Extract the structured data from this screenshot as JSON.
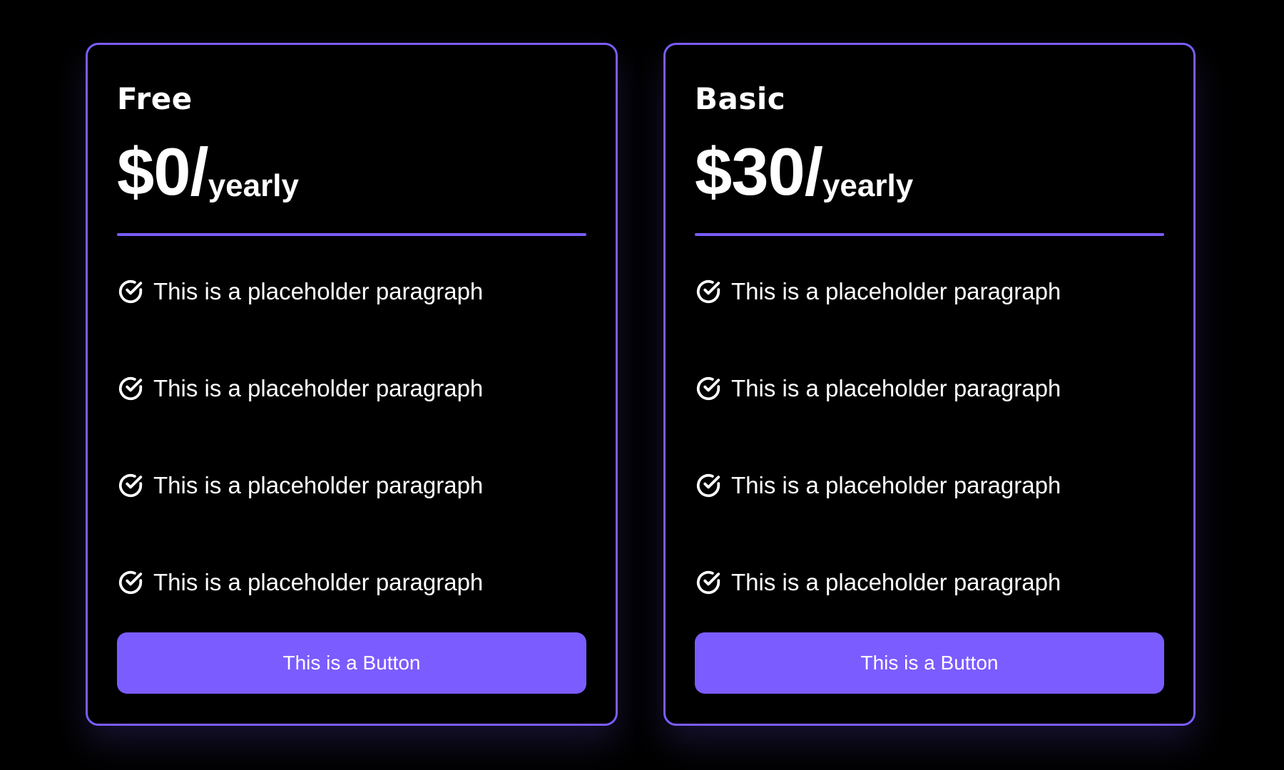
{
  "colors": {
    "background": "#000000",
    "accent": "#7b5cff",
    "text": "#ffffff"
  },
  "plans": [
    {
      "name": "Free",
      "price": "$0/",
      "period": "yearly",
      "features": [
        "This is a placeholder paragraph",
        "This is a placeholder paragraph",
        "This is a placeholder paragraph",
        "This is a placeholder paragraph"
      ],
      "button_label": "This is a Button"
    },
    {
      "name": "Basic",
      "price": "$30/",
      "period": "yearly",
      "features": [
        "This is a placeholder paragraph",
        "This is a placeholder paragraph",
        "This is a placeholder paragraph",
        "This is a placeholder paragraph"
      ],
      "button_label": "This is a Button"
    }
  ],
  "icons": {
    "feature": "check-circle-icon"
  }
}
